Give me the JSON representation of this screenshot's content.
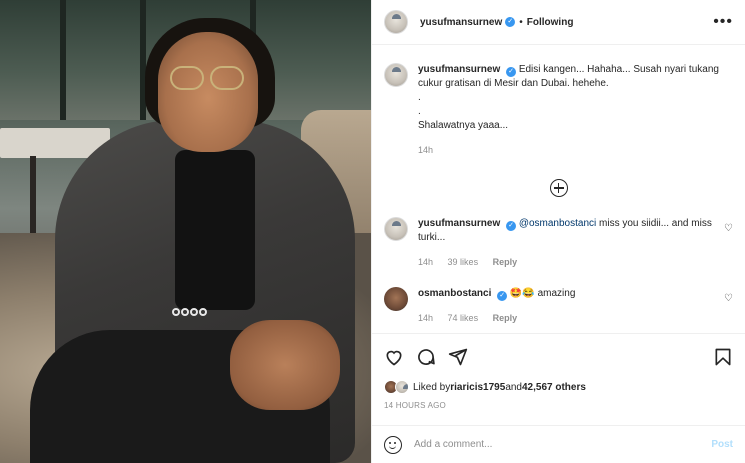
{
  "header": {
    "username": "yusufmansurnew",
    "verified": true,
    "separator": "•",
    "follow_status": "Following",
    "more_icon": "more-horizontal-icon"
  },
  "caption": {
    "username": "yusufmansurnew",
    "line1": "Edisi kangen... Hahaha... Susah nyari tukang cukur gratisan di Mesir dan Dubai. hehehe.",
    "line2": ".",
    "line3": ".",
    "line4": "Shalawatnya yaaa...",
    "time": "14h"
  },
  "load_more_icon": "plus-circle-icon",
  "comments": [
    {
      "username": "yusufmansurnew",
      "mention": "@osmanbostanci",
      "text": " miss you siidii... and miss turki...",
      "time": "14h",
      "likes": "39 likes",
      "reply": "Reply"
    },
    {
      "username": "osmanbostanci",
      "text": "🤩😂 amazing",
      "time": "14h",
      "likes": "74 likes",
      "reply": "Reply"
    }
  ],
  "actions": {
    "icons": [
      "heart-icon",
      "comment-icon",
      "share-icon",
      "bookmark-icon"
    ]
  },
  "likes": {
    "prefix": "Liked by ",
    "user": "riaricis1795",
    "middle": " and ",
    "count": "42,567 others"
  },
  "timestamp": "14 HOURS AGO",
  "add_comment": {
    "placeholder": "Add a comment...",
    "post_label": "Post"
  },
  "colors": {
    "verified": "#3897f0",
    "post_disabled": "#b2dffc",
    "meta": "#8e8e8e"
  }
}
